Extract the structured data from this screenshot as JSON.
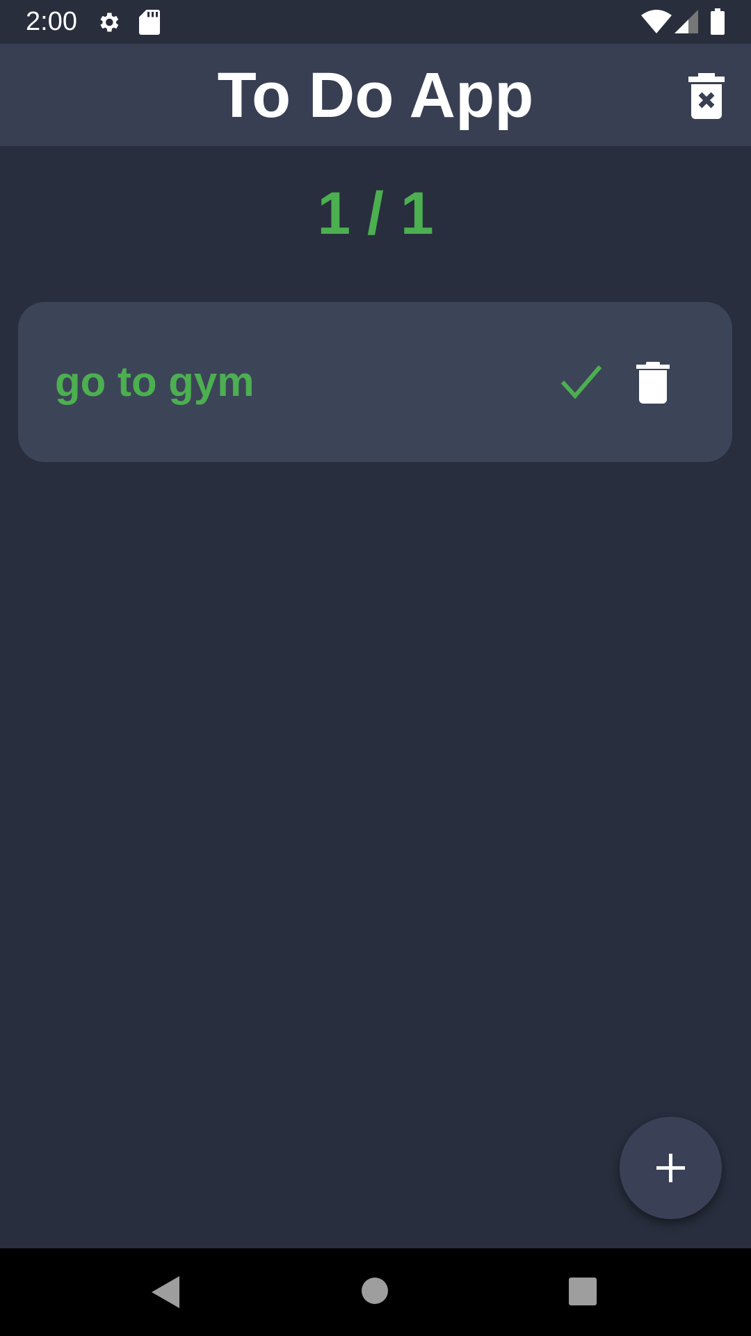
{
  "status_bar": {
    "time": "2:00",
    "icons": [
      "settings-icon",
      "sd-card-icon",
      "wifi-icon",
      "signal-icon",
      "battery-icon"
    ]
  },
  "app_bar": {
    "title": "To Do App",
    "action_icon": "delete-all-icon"
  },
  "counter": "1 / 1",
  "tasks": [
    {
      "text": "go to gym",
      "completed": true
    }
  ],
  "colors": {
    "accent": "#4caf50",
    "background": "#282e3d",
    "card": "#3c4458",
    "app_bar": "#383f52"
  },
  "fab": {
    "icon": "plus-icon"
  },
  "nav_bar": {
    "icons": [
      "back-icon",
      "home-icon",
      "recents-icon"
    ]
  }
}
